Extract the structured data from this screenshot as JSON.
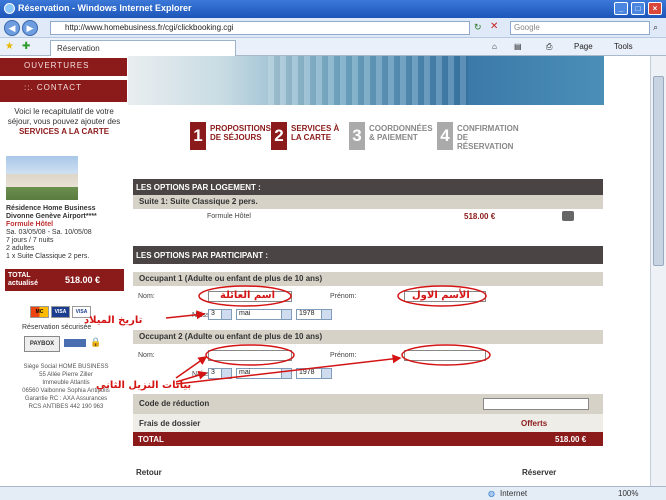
{
  "window": {
    "title": "Réservation - Windows Internet Explorer"
  },
  "browser": {
    "url": "http://www.homebusiness.fr/cgi/clickbooking.cgi",
    "search_placeholder": "Google",
    "tab_title": "Réservation",
    "tools": {
      "page": "Page",
      "tools": "Tools"
    },
    "status": {
      "zone": "Internet",
      "zoom": "100%"
    }
  },
  "left_menu": {
    "items": [
      "OUVERTURES",
      "::. CONTACT"
    ],
    "promo": {
      "line1": "Voici le recapitulatif de votre séjour, vous pouvez ajouter des",
      "line2": "SERVICES A LA CARTE"
    },
    "hotel": {
      "name": "Résidence Home Business Divonne Genève Airport****",
      "formula": "Formule Hôtel",
      "dates": "Sa. 03/05/08 - Sa. 10/05/08",
      "nights": "7 jours / 7 nuits",
      "adults": "2 adultes",
      "room": "1 x Suite Classique 2 pers."
    },
    "total": {
      "label": "TOTAL actualisé",
      "value": "518.00 €"
    },
    "secure": "Réservation sécurisée",
    "paybox": "PAYBOX",
    "cards": [
      "MC",
      "VISA",
      "VISA"
    ],
    "address": [
      "Siège Social HOME BUSINESS",
      "55 Allée Pierre Ziller",
      "Immeuble Atlantis",
      "06560 Valbonne Sophia Antipolis",
      "Garantie RC : AXA Assurances",
      "RCS ANTIBES 442 190 963"
    ]
  },
  "steps": [
    {
      "num": "1",
      "label": "PROPOSITIONS DE SÉJOURS",
      "active": true
    },
    {
      "num": "2",
      "label": "SERVICES À LA CARTE",
      "active": true
    },
    {
      "num": "3",
      "label": "COORDONNÉES & PAIEMENT",
      "active": false
    },
    {
      "num": "4",
      "label": "CONFIRMATION DE RÉSERVATION",
      "active": false
    }
  ],
  "options_logement": {
    "header": "LES OPTIONS PAR LOGEMENT :",
    "suite": "Suite 1: Suite Classique 2 pers.",
    "formule": "Formule Hôtel",
    "price": "518.00 €"
  },
  "options_participant": {
    "header": "LES OPTIONS PAR PARTICIPANT :",
    "occupant1": "Occupant 1 (Adulte ou enfant de plus de 10 ans)",
    "occupant2": "Occupant 2 (Adulte ou enfant de plus de 10 ans)",
    "nom_label": "Nom:",
    "prenom_label": "Prénom:",
    "naiss_label": "Naiss.:",
    "birth_day": "3",
    "birth_month": "mai",
    "birth_year": "1978"
  },
  "summary": {
    "code_label": "Code de réduction",
    "frais_label": "Frais de dossier",
    "frais_value": "Offerts",
    "total_label": "TOTAL",
    "total_value": "518.00 €"
  },
  "footer": {
    "back": "Retour",
    "reserve": "Réserver"
  },
  "annotations": {
    "last_name": "اسم العائلة",
    "first_name": "الأسم الاول",
    "birth_date": "تاريخ الميلاد",
    "second_guest": "بيانات النزيل الثاني"
  }
}
